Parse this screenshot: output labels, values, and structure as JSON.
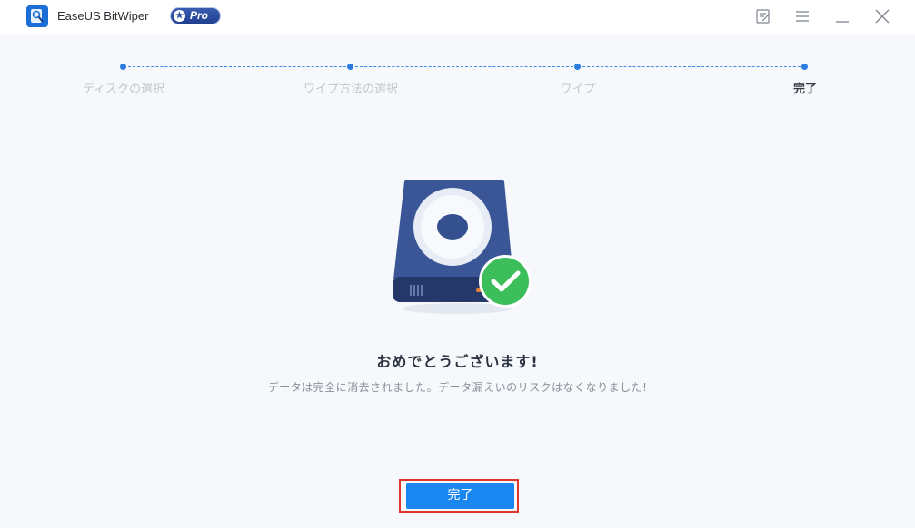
{
  "app": {
    "title": "EaseUS BitWiper",
    "badge": "Pro",
    "logo_icon": "hard-drive-magnifier-icon"
  },
  "window_controls": [
    {
      "icon": "feedback-icon"
    },
    {
      "icon": "menu-icon"
    },
    {
      "icon": "minimize-icon"
    },
    {
      "icon": "close-icon"
    }
  ],
  "steps": {
    "items": [
      {
        "label": "ディスクの選択",
        "active": false
      },
      {
        "label": "ワイプ方法の選択",
        "active": false
      },
      {
        "label": "ワイプ",
        "active": false
      },
      {
        "label": "完了",
        "active": true
      }
    ]
  },
  "main": {
    "illustration": "hard-drive-success-icon",
    "heading": "おめでとうございます!",
    "message": "データは完全に消去されました。データ漏えいのリスクはなくなりました!"
  },
  "actions": {
    "done_label": "完了"
  },
  "colors": {
    "accent": "#1a86f0",
    "success": "#3cbf5a",
    "drive": "#34508f",
    "highlight": "#e0342f"
  }
}
